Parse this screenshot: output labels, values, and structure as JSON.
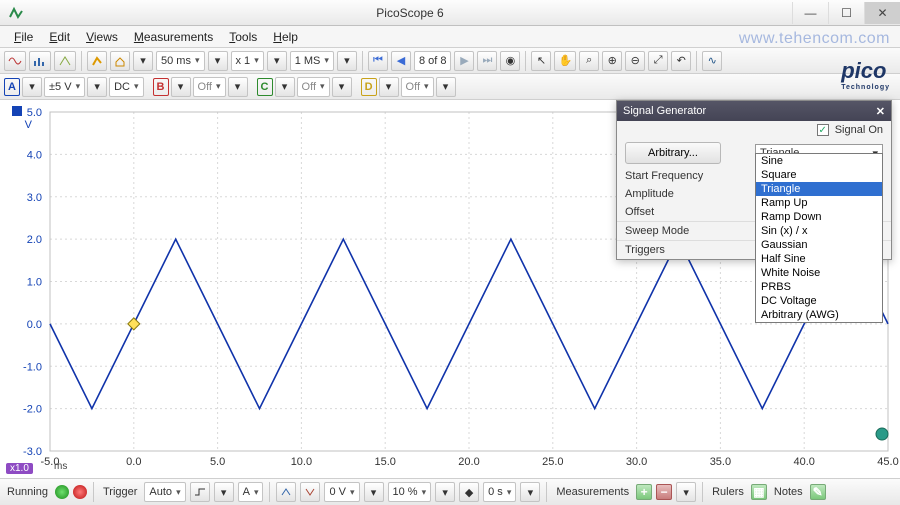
{
  "app": {
    "title": "PicoScope 6"
  },
  "watermark": "www.tehencom.com",
  "brand": {
    "name": "pico",
    "sub": "Technology"
  },
  "menu": {
    "file": "File",
    "edit": "Edit",
    "views": "Views",
    "measurements": "Measurements",
    "tools": "Tools",
    "help": "Help"
  },
  "toolbar1": {
    "timebase": "50 ms",
    "xmult": "x 1",
    "samples": "1 MS",
    "buffer": "8 of 8"
  },
  "channels": {
    "A": {
      "label": "A",
      "range": "±5 V",
      "coupling": "DC"
    },
    "B": {
      "label": "B",
      "state": "Off"
    },
    "C": {
      "label": "C",
      "state": "Off"
    },
    "D": {
      "label": "D",
      "state": "Off"
    }
  },
  "plot": {
    "y_unit": "V",
    "y_ticks": [
      "5.0",
      "4.0",
      "3.0",
      "2.0",
      "1.0",
      "0.0",
      "-1.0",
      "-2.0",
      "-3.0"
    ],
    "x_ticks": [
      "-5.0",
      "0.0",
      "5.0",
      "10.0",
      "15.0",
      "20.0",
      "25.0",
      "30.0",
      "35.0",
      "40.0",
      "45.0"
    ],
    "x_unit": "ms",
    "zoom_tag": "x1.0"
  },
  "chart_data": {
    "type": "line",
    "title": "",
    "xlabel": "ms",
    "ylabel": "V",
    "xlim": [
      -5,
      45
    ],
    "ylim": [
      -3,
      5
    ],
    "x": [
      -5,
      -2.5,
      0,
      2.5,
      5,
      7.5,
      10,
      12.5,
      15,
      17.5,
      20,
      22.5,
      25,
      27.5,
      30,
      32.5,
      35,
      37.5,
      40,
      42.5,
      45
    ],
    "y": [
      0,
      -2,
      0,
      2,
      0,
      -2,
      0,
      2,
      0,
      -2,
      0,
      2,
      0,
      -2,
      0,
      2,
      0,
      -2,
      0,
      2,
      0
    ],
    "series_name": "Channel A",
    "color": "#1033aa",
    "trigger_marker": {
      "x": 0,
      "y": 0
    }
  },
  "siggen": {
    "title": "Signal Generator",
    "signal_on": "Signal On",
    "arbitrary_btn": "Arbitrary...",
    "selected": "Triangle",
    "rows": {
      "start_freq": "Start Frequency",
      "amplitude": "Amplitude",
      "offset": "Offset",
      "sweep": "Sweep Mode",
      "triggers": "Triggers"
    },
    "options": [
      "Sine",
      "Square",
      "Triangle",
      "Ramp Up",
      "Ramp Down",
      "Sin (x) / x",
      "Gaussian",
      "Half Sine",
      "White Noise",
      "PRBS",
      "DC Voltage",
      "Arbitrary (AWG)"
    ]
  },
  "status": {
    "running": "Running",
    "trigger": "Trigger",
    "trigger_mode": "Auto",
    "trigger_src": "A",
    "level": "0 V",
    "pretrig": "10 %",
    "delay": "0 s",
    "measurements": "Measurements",
    "rulers": "Rulers",
    "notes": "Notes"
  }
}
